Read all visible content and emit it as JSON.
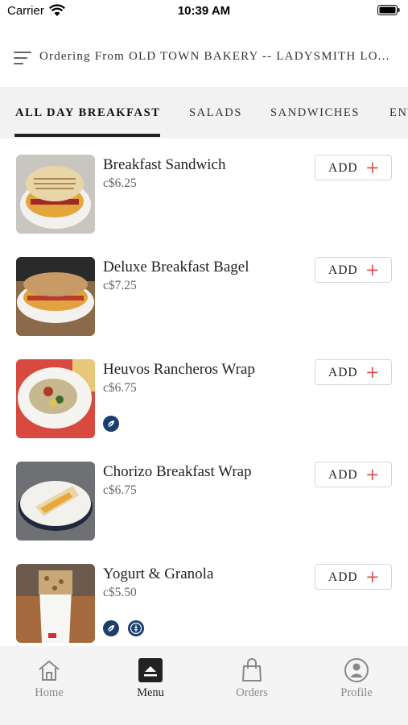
{
  "status_bar": {
    "carrier": "Carrier",
    "time": "10:39 AM"
  },
  "header": {
    "title": "Ordering From OLD TOWN BAKERY -- LADYSMITH LO..."
  },
  "tabs": [
    {
      "label": "ALL DAY BREAKFAST",
      "active": true
    },
    {
      "label": "SALADS"
    },
    {
      "label": "SANDWICHES"
    },
    {
      "label": "ENTREES"
    }
  ],
  "items": [
    {
      "name": "Breakfast Sandwich",
      "price": "c$6.25",
      "add_label": "ADD",
      "add_symbol": "+"
    },
    {
      "name": "Deluxe Breakfast Bagel",
      "price": "c$7.25",
      "add_label": "ADD",
      "add_symbol": "+"
    },
    {
      "name": "Heuvos Rancheros Wrap",
      "price": "c$6.75",
      "add_label": "ADD",
      "add_symbol": "+",
      "badges": [
        "vegetarian-icon"
      ]
    },
    {
      "name": "Chorizo Breakfast Wrap",
      "price": "c$6.75",
      "add_label": "ADD",
      "add_symbol": "+"
    },
    {
      "name": "Yogurt & Granola",
      "price": "c$5.50",
      "add_label": "ADD",
      "add_symbol": "+",
      "badges": [
        "vegetarian-icon",
        "gluten-free-icon"
      ]
    }
  ],
  "bottom_nav": [
    {
      "label": "Home",
      "icon": "home-icon"
    },
    {
      "label": "Menu",
      "icon": "menu-icon",
      "active": true
    },
    {
      "label": "Orders",
      "icon": "shopping-bag-icon"
    },
    {
      "label": "Profile",
      "icon": "profile-icon"
    }
  ],
  "colors": {
    "accent": "#d9534f",
    "badge": "#1b3e6e",
    "tab_bar": "#f2f2f2",
    "nav_bar": "#f4f4f4"
  }
}
